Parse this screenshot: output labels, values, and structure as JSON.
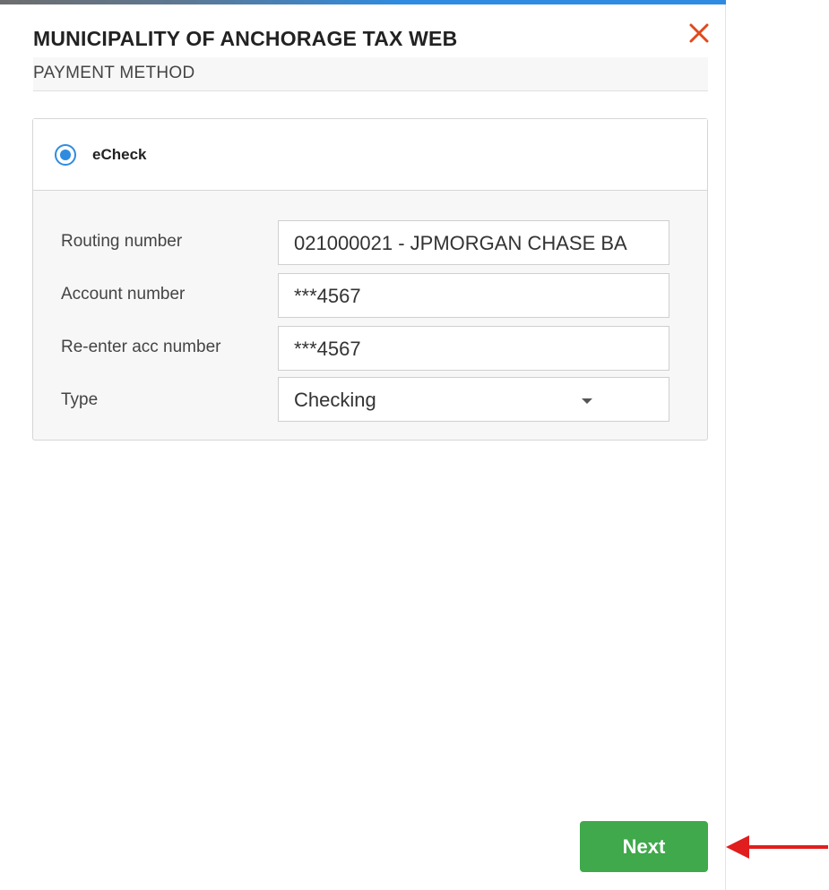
{
  "header": {
    "title": "MUNICIPALITY OF ANCHORAGE TAX WEB",
    "subtitle": "PAYMENT METHOD",
    "close_icon": "close-icon"
  },
  "payment_method": {
    "selected_option": "eCheck",
    "fields": {
      "routing_label": "Routing number",
      "routing_value": "021000021 - JPMORGAN CHASE BA",
      "account_label": "Account number",
      "account_value": "***4567",
      "reenter_label": "Re-enter acc number",
      "reenter_value": "***4567",
      "type_label": "Type",
      "type_value": "Checking"
    }
  },
  "footer": {
    "next_label": "Next"
  },
  "colors": {
    "accent": "#2f8be0",
    "close": "#e04a1c",
    "next_button": "#3fa94b",
    "arrow": "#e01e1e"
  }
}
